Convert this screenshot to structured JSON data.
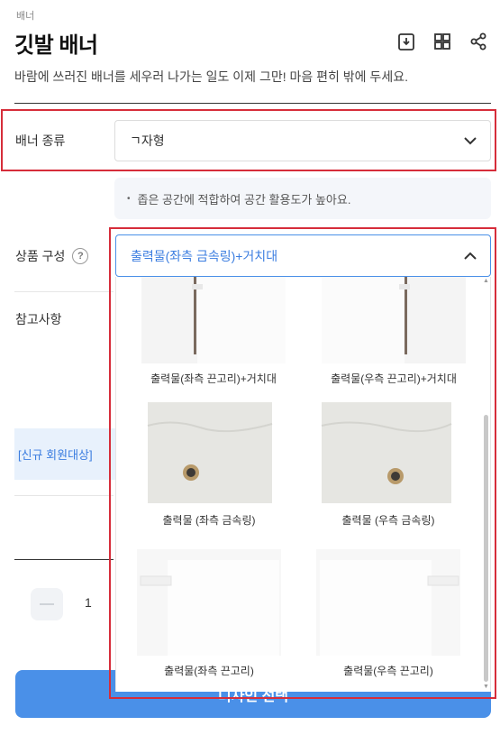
{
  "breadcrumb": "배너",
  "title": "깃발 배너",
  "subtitle": "바람에 쓰러진 배너를 세우러 나가는 일도 이제 그만! 마음 편히 밖에 두세요.",
  "header_icons": [
    "download-icon",
    "grid-icon",
    "share-icon"
  ],
  "banner_type": {
    "label": "배너 종류",
    "value": "ㄱ자형"
  },
  "hint_text": "좁은 공간에 적합하여 공간 활용도가 높아요.",
  "product_config": {
    "label": "상품 구성",
    "help": "?",
    "value": "출력물(좌측 금속링)+거치대",
    "options": [
      {
        "label": "출력물(좌측 끈고리)+거치대"
      },
      {
        "label": "출력물(우측 끈고리)+거치대"
      },
      {
        "label": "출력물 (좌측 금속링)"
      },
      {
        "label": "출력물 (우측 금속링)"
      },
      {
        "label": "출력물(좌측 끈고리)"
      },
      {
        "label": "출력물(우측 끈고리)"
      }
    ]
  },
  "notes_label": "참고사항",
  "promo_text": "[신규 회원대상]",
  "quantity": "1",
  "cta_label": "디자인 선택",
  "colors": {
    "accent": "#4a90e8",
    "highlight_border": "#d62d3a",
    "selected_text": "#3b7de0"
  }
}
